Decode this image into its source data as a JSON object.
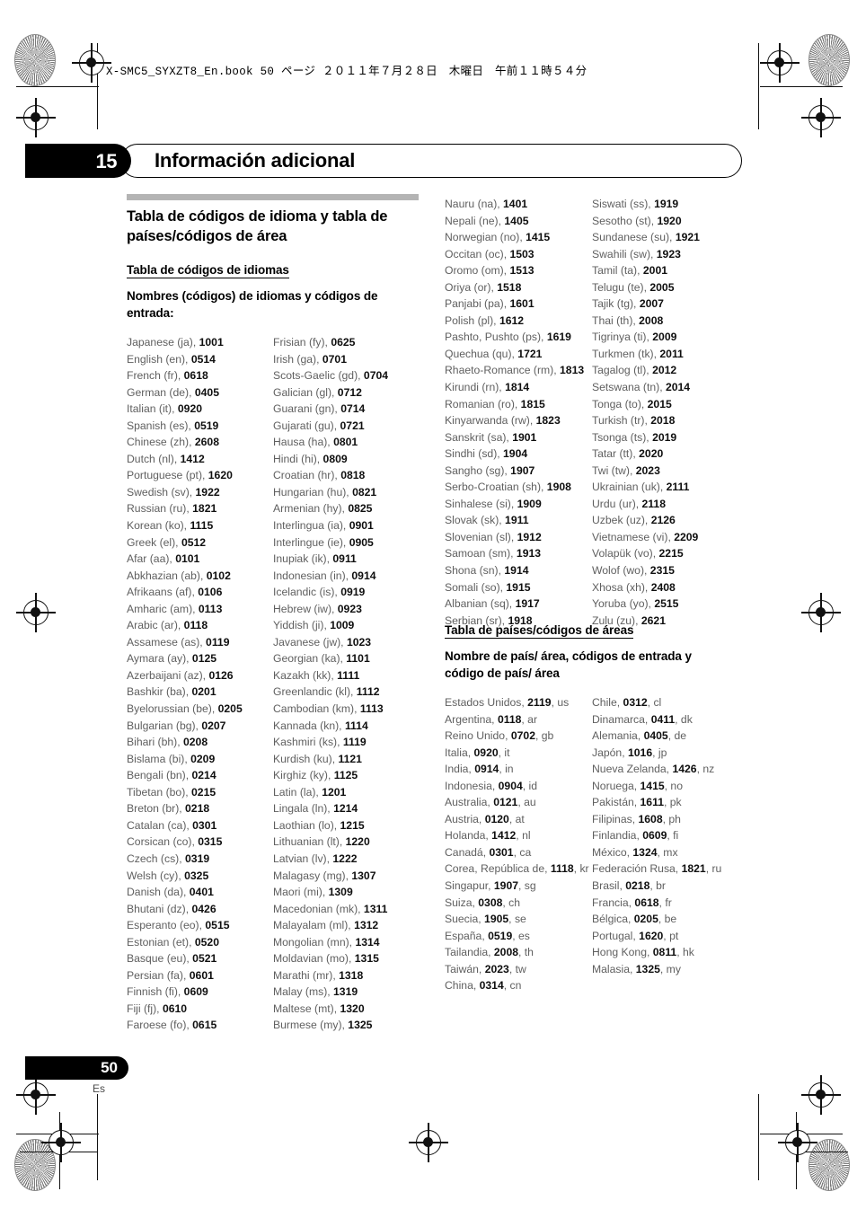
{
  "book_header": "X-SMC5_SYXZT8_En.book   50 ページ   ２０１１年７月２８日　木曜日　午前１１時５４分",
  "chapter": {
    "number": "15",
    "title": "Información adicional"
  },
  "section_title": "Tabla de códigos de idioma y tabla de países/códigos de área",
  "language_table": {
    "heading": "Tabla de códigos de idiomas",
    "subheading": "Nombres (códigos) de idiomas y códigos de entrada:",
    "columns": [
      [
        "Japanese (ja), |1001",
        "English (en), |0514",
        "French (fr), |0618",
        "German (de), |0405",
        "Italian (it), |0920",
        "Spanish (es), |0519",
        "Chinese (zh), |2608",
        "Dutch (nl), |1412",
        "Portuguese (pt), |1620",
        "Swedish (sv), |1922",
        "Russian (ru), |1821",
        "Korean (ko), |1115",
        "Greek (el), |0512",
        "Afar (aa), |0101",
        "Abkhazian (ab), |0102",
        "Afrikaans (af), |0106",
        "Amharic (am), |0113",
        "Arabic (ar), |0118",
        "Assamese (as), |0119",
        "Aymara (ay), |0125",
        "Azerbaijani (az), |0126",
        "Bashkir (ba), |0201",
        "Byelorussian (be), |0205",
        "Bulgarian (bg), |0207",
        "Bihari (bh), |0208",
        "Bislama (bi), |0209",
        "Bengali (bn), |0214",
        "Tibetan (bo), |0215",
        "Breton (br), |0218",
        "Catalan (ca), |0301",
        "Corsican (co), |0315",
        "Czech (cs), |0319",
        "Welsh (cy), |0325",
        "Danish (da), |0401",
        "Bhutani (dz), |0426",
        "Esperanto (eo), |0515",
        "Estonian (et), |0520",
        "Basque (eu), |0521",
        "Persian (fa), |0601",
        "Finnish (fi), |0609",
        "Fiji (fj), |0610",
        "Faroese (fo), |0615"
      ],
      [
        "Frisian (fy), |0625",
        "Irish (ga), |0701",
        "Scots-Gaelic (gd), |0704",
        "Galician (gl), |0712",
        "Guarani (gn), |0714",
        "Gujarati (gu), |0721",
        "Hausa (ha), |0801",
        "Hindi (hi), |0809",
        "Croatian (hr), |0818",
        "Hungarian (hu), |0821",
        "Armenian (hy), |0825",
        "Interlingua (ia), |0901",
        "Interlingue (ie), |0905",
        "Inupiak (ik), |0911",
        "Indonesian (in), |0914",
        "Icelandic (is), |0919",
        "Hebrew (iw), |0923",
        "Yiddish (ji), |1009",
        "Javanese (jw), |1023",
        "Georgian (ka), |1101",
        "Kazakh (kk), |1111",
        "Greenlandic (kl), |1112",
        "Cambodian (km), |1113",
        "Kannada (kn), |1114",
        "Kashmiri (ks), |1119",
        "Kurdish (ku), |1121",
        "Kirghiz (ky), |1125",
        "Latin (la), |1201",
        "Lingala (ln), |1214",
        "Laothian (lo), |1215",
        "Lithuanian (lt), |1220",
        "Latvian (lv), |1222",
        "Malagasy (mg), |1307",
        "Maori (mi), |1309",
        "Macedonian (mk), |1311",
        "Malayalam (ml), |1312",
        "Mongolian (mn), |1314",
        "Moldavian (mo), |1315",
        "Marathi (mr), |1318",
        "Malay (ms), |1319",
        "Maltese (mt), |1320",
        "Burmese (my), |1325"
      ],
      [
        "Nauru (na), |1401",
        "Nepali (ne), |1405",
        "Norwegian (no), |1415",
        "Occitan (oc), |1503",
        "Oromo (om), |1513",
        "Oriya (or), |1518",
        "Panjabi (pa), |1601",
        "Polish (pl), |1612",
        "Pashto, Pushto (ps), |1619",
        "Quechua (qu), |1721",
        "Rhaeto-Romance (rm), |1813",
        "Kirundi (rn), |1814",
        "Romanian (ro), |1815",
        "Kinyarwanda (rw), |1823",
        "Sanskrit (sa), |1901",
        "Sindhi (sd), |1904",
        "Sangho (sg), |1907",
        "Serbo-Croatian (sh), |1908",
        "Sinhalese (si), |1909",
        "Slovak (sk), |1911",
        "Slovenian (sl), |1912",
        "Samoan (sm), |1913",
        "Shona (sn), |1914",
        "Somali (so), |1915",
        "Albanian (sq), |1917",
        "Serbian (sr), |1918"
      ],
      [
        "Siswati (ss), |1919",
        "Sesotho (st), |1920",
        "Sundanese (su), |1921",
        "Swahili (sw), |1923",
        "Tamil (ta), |2001",
        "Telugu (te), |2005",
        "Tajik (tg), |2007",
        "Thai (th), |2008",
        "Tigrinya (ti), |2009",
        "Turkmen (tk), |2011",
        "Tagalog (tl), |2012",
        "Setswana (tn), |2014",
        "Tonga (to), |2015",
        "Turkish (tr), |2018",
        "Tsonga (ts), |2019",
        "Tatar (tt), |2020",
        "Twi (tw), |2023",
        "Ukrainian (uk), |2111",
        "Urdu (ur), |2118",
        "Uzbek (uz), |2126",
        "Vietnamese (vi), |2209",
        "Volapük (vo), |2215",
        "Wolof (wo), |2315",
        "Xhosa (xh), |2408",
        "Yoruba (yo), |2515",
        "Zulu (zu), |2621"
      ]
    ]
  },
  "country_table": {
    "heading": "Tabla de países/códigos de áreas",
    "subheading": "Nombre de país/ área, códigos de entrada y código de país/ área",
    "columns": [
      [
        "Estados Unidos, |2119|, us",
        "Argentina, |0118|, ar",
        "Reino Unido, |0702|, gb",
        "Italia, |0920|, it",
        "India, |0914|, in",
        "Indonesia, |0904|, id",
        "Australia, |0121|, au",
        "Austria, |0120|, at",
        "Holanda, |1412|, nl",
        "Canadá, |0301|, ca",
        "Corea, República de, |1118|, kr",
        "Singapur, |1907|, sg",
        "Suiza, |0308|, ch",
        "Suecia, |1905|, se",
        "España, |0519|, es",
        "Tailandia, |2008|, th",
        "Taiwán, |2023|, tw",
        "China, |0314|, cn"
      ],
      [
        "Chile, |0312|, cl",
        "Dinamarca, |0411|, dk",
        "Alemania, |0405|, de",
        "Japón, |1016|, jp",
        "Nueva Zelanda, |1426|, nz",
        "Noruega, |1415|, no",
        "Pakistán, |1611|, pk",
        "Filipinas, |1608|, ph",
        "Finlandia, |0609|, fi",
        "México, |1324|, mx",
        "Federación Rusa, |1821|, ru",
        "Brasil, |0218|, br",
        "Francia, |0618|, fr",
        "Bélgica, |0205|, be",
        "Portugal, |1620|, pt",
        "Hong Kong, |0811|, hk",
        "Malasia, |1325|, my"
      ]
    ]
  },
  "footer": {
    "page_number": "50",
    "language_code": "Es"
  },
  "colors": {
    "rule_gray": "#b4b4b4",
    "body_text": "#5f5f5f",
    "code_text": "#0f0f0f",
    "accent_black": "#000000"
  }
}
